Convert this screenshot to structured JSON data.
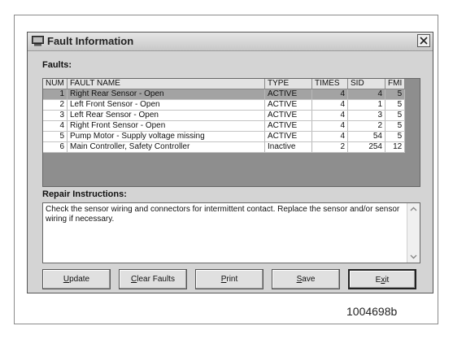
{
  "window": {
    "title": "Fault Information",
    "app_icon": "computer-icon",
    "close_icon": "close-icon"
  },
  "faults": {
    "label": "Faults:",
    "columns": [
      "NUM",
      "FAULT NAME",
      "TYPE",
      "TIMES",
      "SID",
      "FMI"
    ],
    "rows": [
      {
        "num": "1",
        "name": "Right Rear Sensor - Open",
        "type": "ACTIVE",
        "times": "4",
        "sid": "4",
        "fmi": "5",
        "selected": true
      },
      {
        "num": "2",
        "name": "Left Front Sensor - Open",
        "type": "ACTIVE",
        "times": "4",
        "sid": "1",
        "fmi": "5",
        "selected": false
      },
      {
        "num": "3",
        "name": "Left Rear Sensor - Open",
        "type": "ACTIVE",
        "times": "4",
        "sid": "3",
        "fmi": "5",
        "selected": false
      },
      {
        "num": "4",
        "name": "Right Front Sensor - Open",
        "type": "ACTIVE",
        "times": "4",
        "sid": "2",
        "fmi": "5",
        "selected": false
      },
      {
        "num": "5",
        "name": "Pump Motor - Supply voltage missing",
        "type": "ACTIVE",
        "times": "4",
        "sid": "54",
        "fmi": "5",
        "selected": false
      },
      {
        "num": "6",
        "name": "Main Controller, Safety Controller",
        "type": "Inactive",
        "times": "2",
        "sid": "254",
        "fmi": "12",
        "selected": false
      }
    ]
  },
  "repair": {
    "label": "Repair Instructions:",
    "text": "Check the sensor wiring and connectors for intermittent contact.  Replace the sensor and/or sensor wiring if necessary."
  },
  "buttons": {
    "update": {
      "label": "Update",
      "mnemonic_index": 0
    },
    "clear_faults": {
      "label": "Clear Faults",
      "mnemonic_index": 0
    },
    "print": {
      "label": "Print",
      "mnemonic_index": 0
    },
    "save": {
      "label": "Save",
      "mnemonic_index": 0
    },
    "exit": {
      "label": "Exit",
      "mnemonic_index": 1
    }
  },
  "figure_id": "1004698b"
}
